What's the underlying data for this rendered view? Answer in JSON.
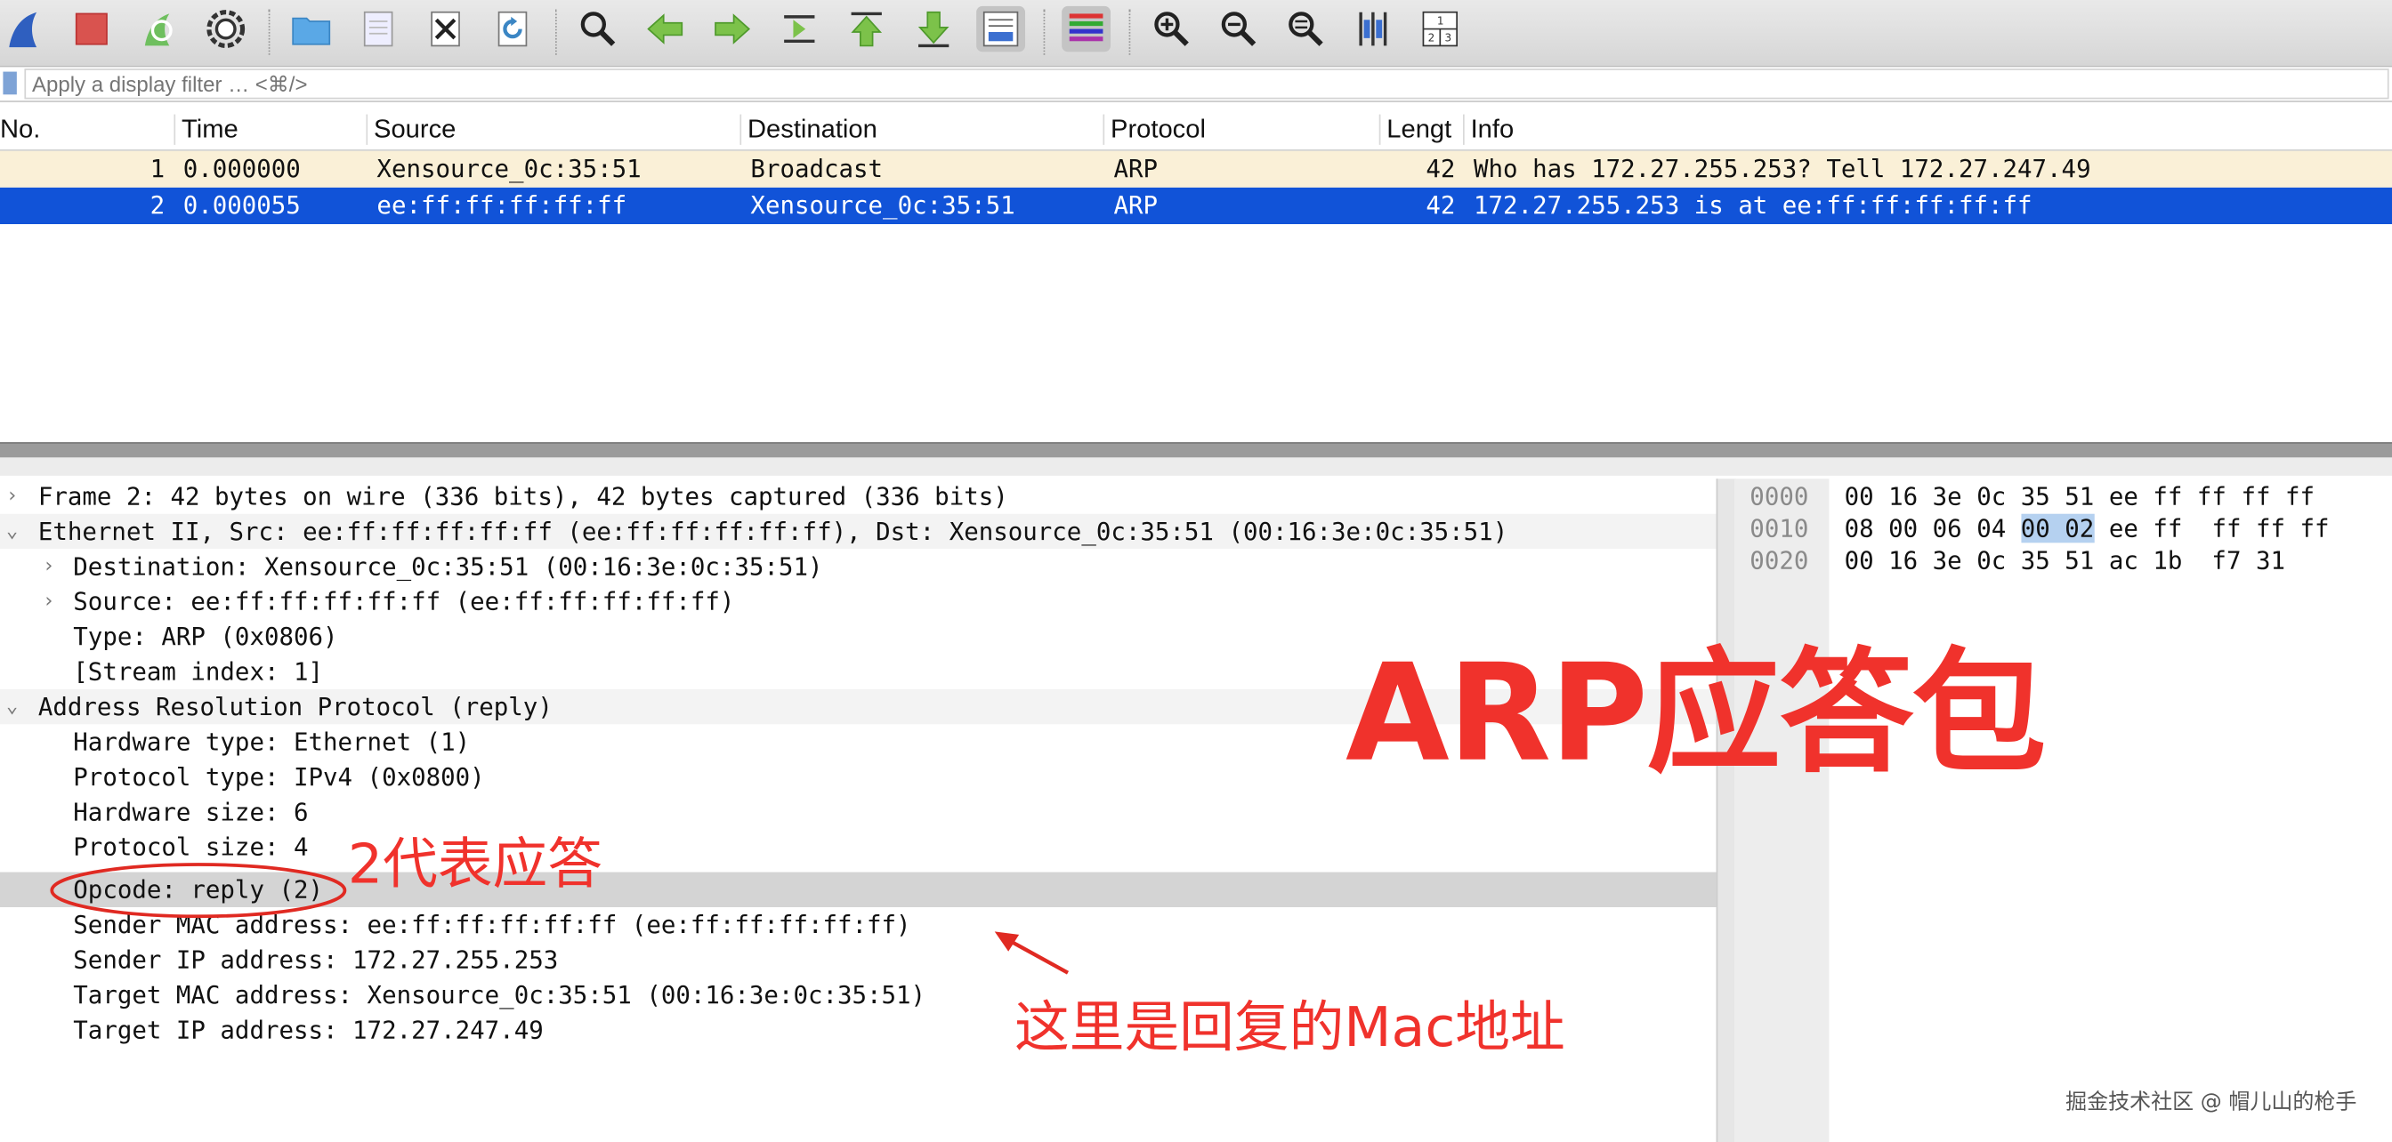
{
  "toolbar": {
    "buttons": [
      "shark-fin-icon",
      "stop-icon",
      "restart-icon",
      "gear-icon",
      "folder-icon",
      "file-icon",
      "close-file-icon",
      "reload-icon",
      "search-icon",
      "back-arrow-icon",
      "forward-arrow-icon",
      "jump-icon",
      "first-packet-icon",
      "last-packet-icon",
      "autoscroll-icon",
      "colorize-icon",
      "zoom-in-icon",
      "zoom-out-icon",
      "zoom-reset-icon",
      "resize-columns-icon",
      "layout-icon"
    ]
  },
  "filter": {
    "placeholder": "Apply a display filter … <⌘/>"
  },
  "packet_list": {
    "columns": [
      "No.",
      "Time",
      "Source",
      "Destination",
      "Protocol",
      "Lengt",
      "Info"
    ],
    "rows": [
      {
        "no": "1",
        "time": "0.000000",
        "source": "Xensource_0c:35:51",
        "destination": "Broadcast",
        "protocol": "ARP",
        "length": "42",
        "info": "Who has 172.27.255.253? Tell 172.27.247.49"
      },
      {
        "no": "2",
        "time": "0.000055",
        "source": "ee:ff:ff:ff:ff:ff",
        "destination": "Xensource_0c:35:51",
        "protocol": "ARP",
        "length": "42",
        "info": "172.27.255.253 is at ee:ff:ff:ff:ff:ff"
      }
    ]
  },
  "details": [
    {
      "arrow": "›",
      "text": "Frame 2: 42 bytes on wire (336 bits), 42 bytes captured (336 bits)"
    },
    {
      "arrow": "⌄",
      "text": "Ethernet II, Src: ee:ff:ff:ff:ff:ff (ee:ff:ff:ff:ff:ff), Dst: Xensource_0c:35:51 (00:16:3e:0c:35:51)"
    },
    {
      "arrow": "›",
      "text": "Destination: Xensource_0c:35:51 (00:16:3e:0c:35:51)"
    },
    {
      "arrow": "›",
      "text": "Source: ee:ff:ff:ff:ff:ff (ee:ff:ff:ff:ff:ff)"
    },
    {
      "arrow": "",
      "text": "Type: ARP (0x0806)"
    },
    {
      "arrow": "",
      "text": "[Stream index: 1]"
    },
    {
      "arrow": "⌄",
      "text": "Address Resolution Protocol (reply)"
    },
    {
      "arrow": "",
      "text": "Hardware type: Ethernet (1)"
    },
    {
      "arrow": "",
      "text": "Protocol type: IPv4 (0x0800)"
    },
    {
      "arrow": "",
      "text": "Hardware size: 6"
    },
    {
      "arrow": "",
      "text": "Protocol size: 4"
    },
    {
      "arrow": "",
      "text": "Opcode: reply (2)"
    },
    {
      "arrow": "",
      "text": "Sender MAC address: ee:ff:ff:ff:ff:ff (ee:ff:ff:ff:ff:ff)"
    },
    {
      "arrow": "",
      "text": "Sender IP address: 172.27.255.253"
    },
    {
      "arrow": "",
      "text": "Target MAC address: Xensource_0c:35:51 (00:16:3e:0c:35:51)"
    },
    {
      "arrow": "",
      "text": "Target IP address: 172.27.247.49"
    }
  ],
  "hex": [
    {
      "offset": "0000",
      "pre": "00 16 3e 0c 35 51 ee ff  ff ff ff",
      "hl": "",
      "post": ""
    },
    {
      "offset": "0010",
      "pre": "08 00 06 04 ",
      "hl": "00 02",
      "post": " ee ff  ff ff ff"
    },
    {
      "offset": "0020",
      "pre": "00 16 3e 0c 35 51 ac 1b  f7 31",
      "hl": "",
      "post": ""
    }
  ],
  "annotations": {
    "title": "ARP应答包",
    "opcode_note": "2代表应答",
    "mac_note": "这里是回复的Mac地址",
    "watermark": "掘金技术社区 @ 帽儿山的枪手"
  },
  "colors": {
    "selection": "#1153d8",
    "annotation": "#f0322c",
    "row_highlight": "#faf0d7"
  }
}
